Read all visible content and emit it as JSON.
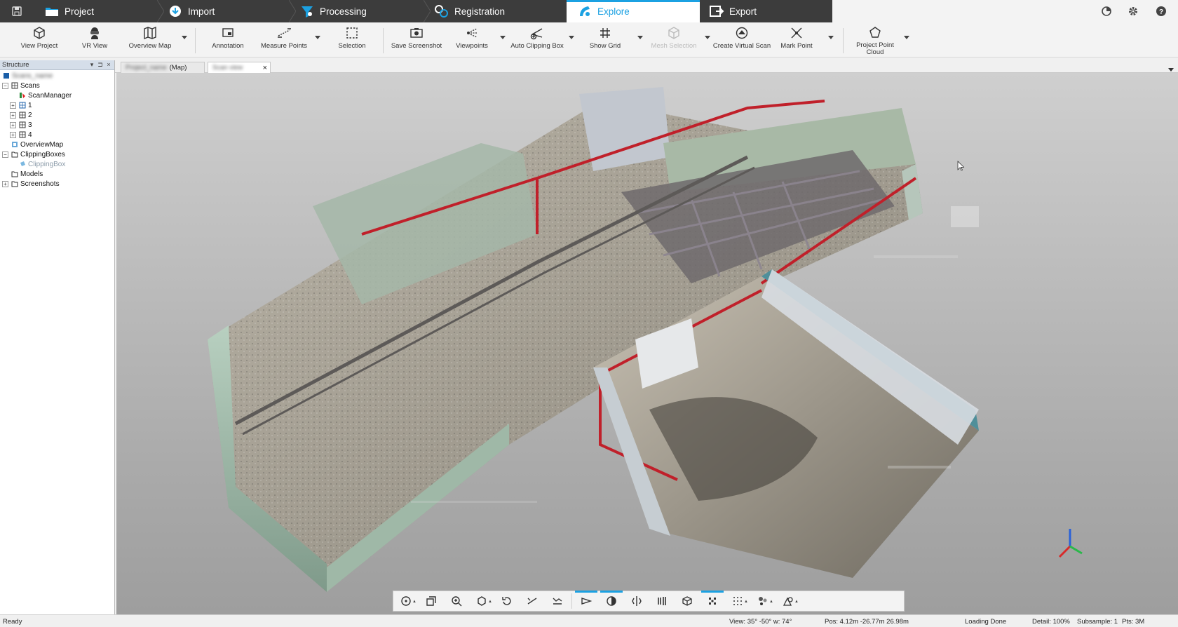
{
  "workflow_tabs": [
    {
      "label": "Project",
      "icon": "folder-icon",
      "active": false
    },
    {
      "label": "Import",
      "icon": "import-icon",
      "active": false
    },
    {
      "label": "Processing",
      "icon": "funnel-icon",
      "active": false
    },
    {
      "label": "Registration",
      "icon": "registration-icon",
      "active": false
    },
    {
      "label": "Explore",
      "icon": "explore-icon",
      "active": true
    },
    {
      "label": "Export",
      "icon": "export-icon",
      "active": false
    }
  ],
  "ribbon": {
    "view_project": "View Project",
    "vr_view": "VR View",
    "overview_map": "Overview Map",
    "annotation": "Annotation",
    "measure_points": "Measure Points",
    "selection": "Selection",
    "save_screenshot": "Save Screenshot",
    "viewpoints": "Viewpoints",
    "auto_clipping_box": "Auto Clipping Box",
    "show_grid": "Show Grid",
    "mesh_selection": "Mesh Selection",
    "create_virtual_scan": "Create Virtual Scan",
    "mark_point": "Mark Point",
    "project_point_cloud_1": "Project Point",
    "project_point_cloud_2": "Cloud"
  },
  "structure": {
    "title": "Structure",
    "root_label": "Scans_name",
    "items": {
      "scans": "Scans",
      "scan_manager": "ScanManager",
      "scan1": "1",
      "scan2": "2",
      "scan3": "3",
      "scan4": "4",
      "overview_map": "OverviewMap",
      "clipping_boxes": "ClippingBoxes",
      "clipping_box": "ClippingBox",
      "models": "Models",
      "screenshots": "Screenshots"
    }
  },
  "doc_tabs": {
    "tab1_name": "Project_name",
    "tab1_suffix": "(Map)",
    "tab2_name": "Scan view"
  },
  "status": {
    "ready": "Ready",
    "view": "View: 35° -50° w: 74°",
    "pos": "Pos: 4.12m -26.77m 26.98m",
    "loading": "Loading Done",
    "detail": "Detail: 100%",
    "subsample": "Subsample:  1",
    "pts": "Pts:   3M"
  },
  "colors": {
    "accent": "#1ba1e2",
    "tabbar": "#3c3c3c"
  }
}
